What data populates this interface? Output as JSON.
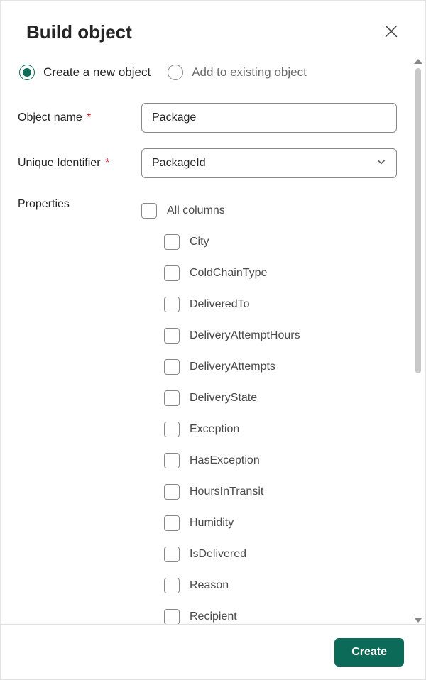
{
  "header": {
    "title": "Build object"
  },
  "mode": {
    "create_label": "Create a new object",
    "add_label": "Add to existing object",
    "selected": "create"
  },
  "fields": {
    "object_name_label": "Object name",
    "object_name_value": "Package",
    "unique_id_label": "Unique Identifier",
    "unique_id_value": "PackageId",
    "properties_label": "Properties"
  },
  "properties": {
    "all_columns_label": "All columns",
    "items": [
      "City",
      "ColdChainType",
      "DeliveredTo",
      "DeliveryAttemptHours",
      "DeliveryAttempts",
      "DeliveryState",
      "Exception",
      "HasException",
      "HoursInTransit",
      "Humidity",
      "IsDelivered",
      "Reason",
      "Recipient"
    ]
  },
  "footer": {
    "create_label": "Create"
  }
}
